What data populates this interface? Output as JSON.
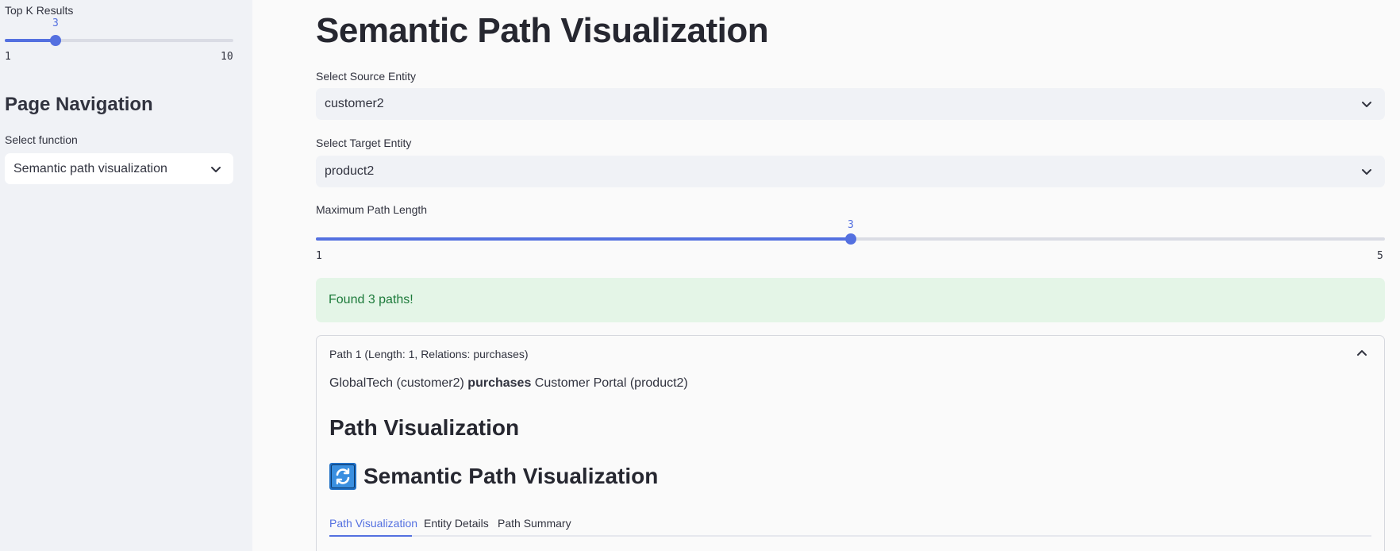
{
  "sidebar": {
    "topk": {
      "label": "Top K Results",
      "value": "3",
      "min": "1",
      "max": "10",
      "fraction": 0.222
    },
    "nav_heading": "Page Navigation",
    "function_label": "Select function",
    "function_value": "Semantic path visualization"
  },
  "main": {
    "title": "Semantic Path Visualization",
    "source": {
      "label": "Select Source Entity",
      "value": "customer2"
    },
    "target": {
      "label": "Select Target Entity",
      "value": "product2"
    },
    "max_path": {
      "label": "Maximum Path Length",
      "value": "3",
      "min": "1",
      "max": "5",
      "fraction": 0.5
    },
    "success_message": "Found 3 paths!",
    "expander": {
      "header": "Path 1 (Length: 1, Relations: purchases)",
      "path_source": "GlobalTech (customer2)",
      "path_relation": "purchases",
      "path_target": "Customer Portal (product2)",
      "heading": "Path Visualization",
      "subheading": "Semantic Path Visualization",
      "tabs": [
        "Path Visualization",
        "Entity Details",
        "Path Summary"
      ]
    }
  },
  "colors": {
    "accent": "#5470e0",
    "success_bg": "#e4f5e7",
    "success_text": "#1c7a3a",
    "sidebar_bg": "#f0f2f6"
  },
  "icons": {
    "dropdown": "chevron-down-icon",
    "collapse": "chevron-up-icon",
    "refresh": "refresh-icon"
  }
}
